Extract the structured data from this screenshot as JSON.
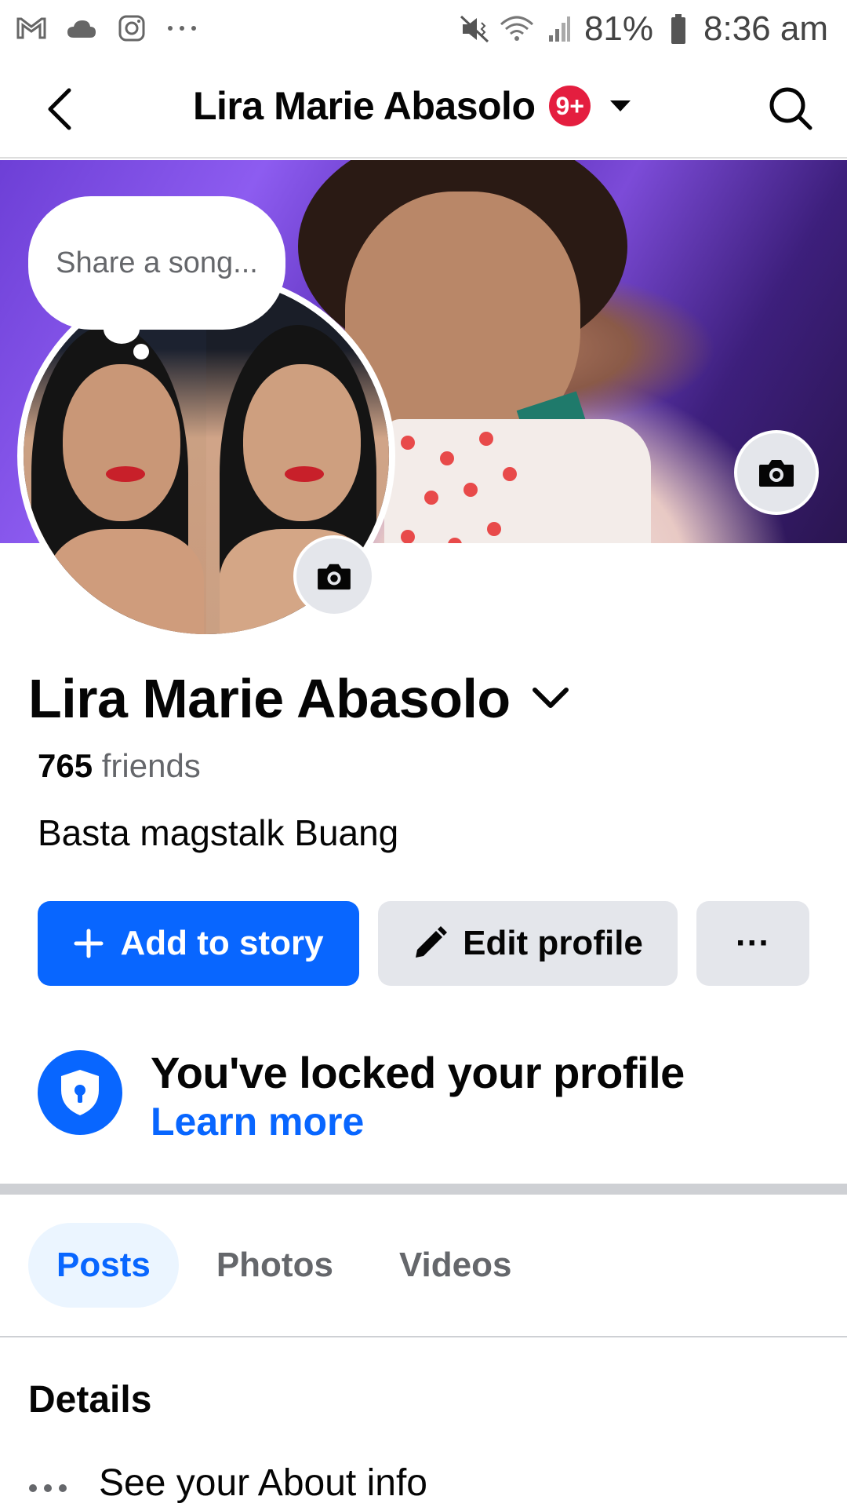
{
  "status_bar": {
    "icons_left": [
      "gmail-icon",
      "cloud-icon",
      "instagram-icon",
      "more-dots-icon"
    ],
    "icons_right": [
      "mute-vibrate-icon",
      "wifi-icon",
      "signal-icon",
      "battery-icon"
    ],
    "battery": "81%",
    "time": "8:36 am"
  },
  "header": {
    "title": "Lira Marie Abasolo",
    "notification_badge": "9+",
    "accent": "#e41e3f"
  },
  "cover": {
    "song_bubble": "Share a song..."
  },
  "profile": {
    "name": "Lira Marie Abasolo",
    "friends_count": "765",
    "friends_label": "friends",
    "bio": "Basta magstalk Buang"
  },
  "actions": {
    "add_story": "Add to story",
    "edit_profile": "Edit profile",
    "more": "···",
    "primary_color": "#0866ff"
  },
  "locked": {
    "title": "You've locked your profile",
    "link": "Learn more"
  },
  "tabs": [
    {
      "label": "Posts",
      "active": true
    },
    {
      "label": "Photos",
      "active": false
    },
    {
      "label": "Videos",
      "active": false
    }
  ],
  "details": {
    "title": "Details",
    "about_label": "See your About info"
  }
}
